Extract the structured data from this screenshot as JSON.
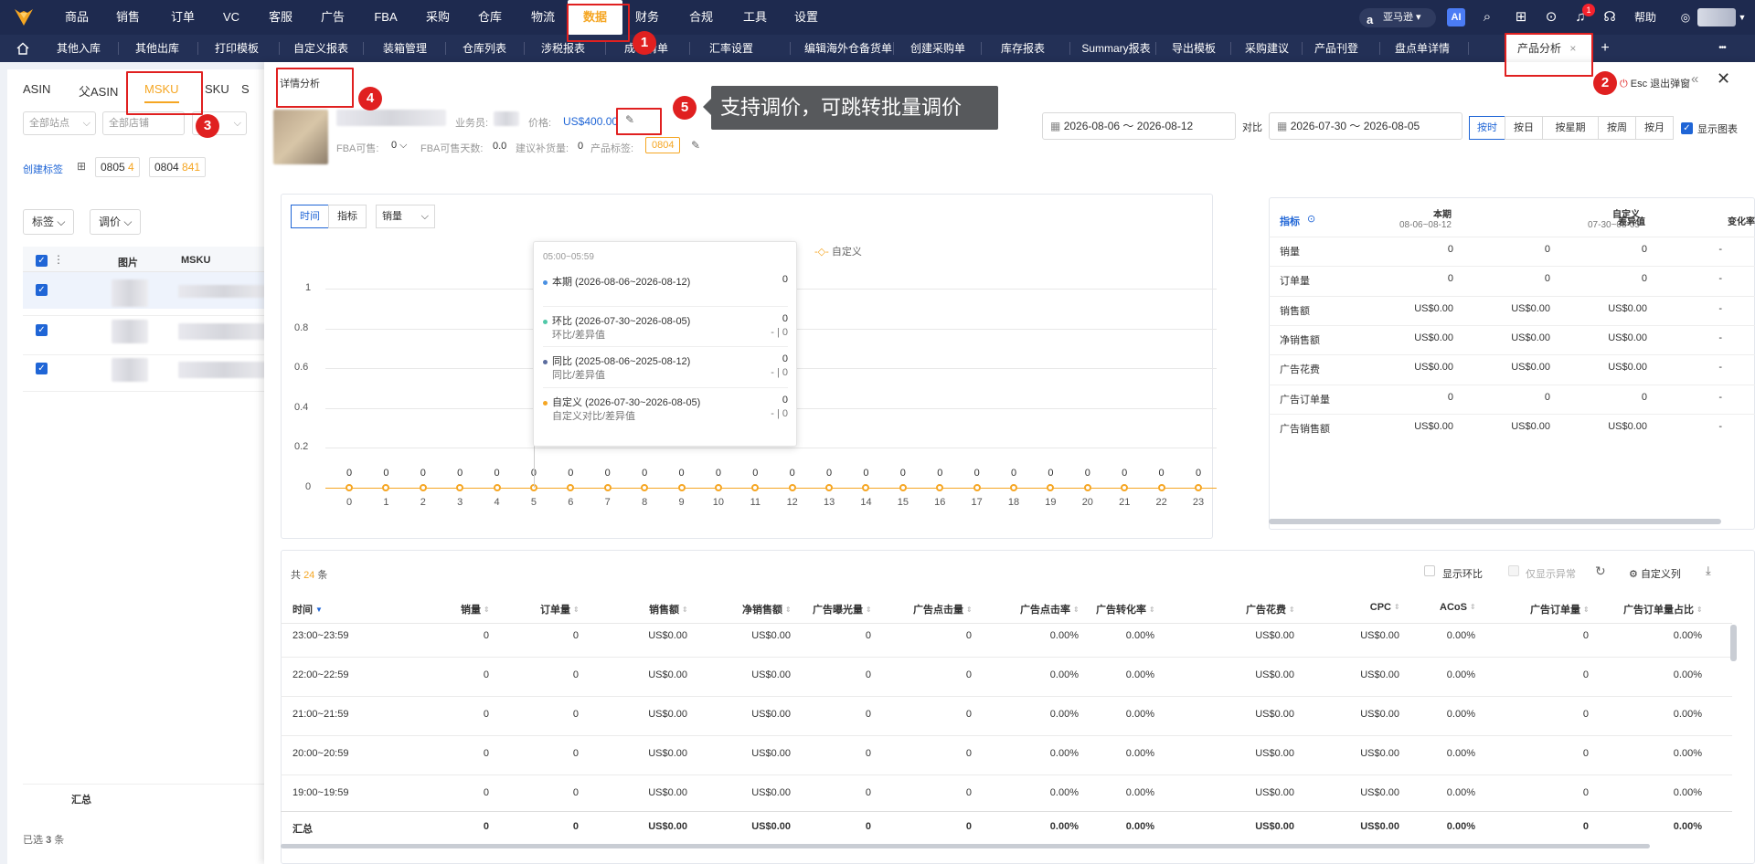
{
  "topnav": {
    "items": [
      "商品",
      "销售",
      "订单",
      "VC",
      "客服",
      "广告",
      "FBA",
      "采购",
      "仓库",
      "物流",
      "数据",
      "财务",
      "合规",
      "工具",
      "设置"
    ],
    "active": "数据",
    "marketplace": "亚马逊",
    "marketplace_icon": "a",
    "ai_label": "AI",
    "bell_count": "1",
    "help": "帮助"
  },
  "tabbar": {
    "tabs": [
      "其他入库",
      "其他出库",
      "打印模板",
      "自定义报表",
      "装箱管理",
      "仓库列表",
      "涉税报表",
      "成本清单",
      "汇率设置",
      "编辑海外仓备货单",
      "创建采购单",
      "库存报表",
      "Summary报表",
      "导出模板",
      "采购建议",
      "产品刊登",
      "盘点单详情"
    ],
    "active_tab": "产品分析",
    "close": "×",
    "add": "+",
    "more": "•••"
  },
  "left": {
    "tabs": [
      "ASIN",
      "父ASIN",
      "MSKU",
      "SKU",
      "S"
    ],
    "active_tab": "MSKU",
    "filters": [
      "全部站点",
      "全部店铺"
    ],
    "create_tag": "创建标签",
    "chips": [
      {
        "label": "0805",
        "count": "4"
      },
      {
        "label": "0804",
        "count": "841"
      }
    ],
    "btn_tag": "标签",
    "btn_price": "调价",
    "col_image": "图片",
    "col_msku": "MSKU",
    "total_label": "汇总",
    "selected_prefix": "已选",
    "selected_count": "3",
    "selected_suffix": "条"
  },
  "modal": {
    "title": "详情分析",
    "esc_text": "Esc 退出弹窗",
    "salesperson_label": "业务员:",
    "price_label": "价格:",
    "price_value": "US$400.00",
    "fba_avail_label": "FBA可售:",
    "fba_avail_value": "0",
    "fba_days_label": "FBA可售天数:",
    "fba_days_value": "0.0",
    "suggest_label": "建议补货量:",
    "suggest_value": "0",
    "tag_label": "产品标签:",
    "tag_value": "0804",
    "date_current_start": "2026-08-06",
    "date_current_end": "2026-08-12",
    "date_sep": "～",
    "compare_label": "对比",
    "date_compare_start": "2026-07-30",
    "date_compare_end": "2026-08-05",
    "granularity": [
      "按时",
      "按日",
      "按星期",
      "按周",
      "按月"
    ],
    "granularity_active": "按时",
    "show_chart": "显示图表"
  },
  "annotations": {
    "badges": [
      "1",
      "2",
      "3",
      "4",
      "5"
    ],
    "callout": "支持调价，可跳转批量调价"
  },
  "chart": {
    "tab_time": "时间",
    "tab_metric": "指标",
    "metric_select": "销量",
    "legend_custom": "自定义"
  },
  "chart_data": {
    "type": "line",
    "x": [
      0,
      1,
      2,
      3,
      4,
      5,
      6,
      7,
      8,
      9,
      10,
      11,
      12,
      13,
      14,
      15,
      16,
      17,
      18,
      19,
      20,
      21,
      22,
      23
    ],
    "series": [
      {
        "name": "自定义",
        "values": [
          0,
          0,
          0,
          0,
          0,
          0,
          0,
          0,
          0,
          0,
          0,
          0,
          0,
          0,
          0,
          0,
          0,
          0,
          0,
          0,
          0,
          0,
          0,
          0
        ],
        "color": "#f5a623"
      }
    ],
    "yticks": [
      "0",
      "0.2",
      "0.4",
      "0.6",
      "0.8",
      "1"
    ],
    "ylim": [
      0,
      1
    ],
    "grid": true
  },
  "tooltip": {
    "time": "05:00~05:59",
    "rows": [
      {
        "label": "本期 (2026-08-06~2026-08-12)",
        "value": "0",
        "color": "#4a90e2",
        "sub": "",
        "subval": ""
      },
      {
        "label": "环比 (2026-07-30~2026-08-05)",
        "value": "0",
        "color": "#50c8a8",
        "sub": "环比/差异值",
        "subval": "- | 0"
      },
      {
        "label": "同比 (2025-08-06~2025-08-12)",
        "value": "0",
        "color": "#5b6c9e",
        "sub": "同比/差异值",
        "subval": "- | 0"
      },
      {
        "label": "自定义 (2026-07-30~2026-08-05)",
        "value": "0",
        "color": "#f5a623",
        "sub": "自定义对比/差异值",
        "subval": "- | 0"
      }
    ]
  },
  "metrics_table": {
    "head": {
      "metric": "指标",
      "current": "本期",
      "current_range": "08-06~08-12",
      "custom": "自定义",
      "custom_range": "07-30~08-05",
      "diff": "差异值",
      "rate": "变化率"
    },
    "rows": [
      [
        "销量",
        "0",
        "0",
        "0",
        "-"
      ],
      [
        "订单量",
        "0",
        "0",
        "0",
        "-"
      ],
      [
        "销售额",
        "US$0.00",
        "US$0.00",
        "US$0.00",
        "-"
      ],
      [
        "净销售额",
        "US$0.00",
        "US$0.00",
        "US$0.00",
        "-"
      ],
      [
        "广告花费",
        "US$0.00",
        "US$0.00",
        "US$0.00",
        "-"
      ],
      [
        "广告订单量",
        "0",
        "0",
        "0",
        "-"
      ],
      [
        "广告销售额",
        "US$0.00",
        "US$0.00",
        "US$0.00",
        "-"
      ]
    ]
  },
  "detail_table": {
    "count_prefix": "共",
    "count": "24",
    "count_suffix": "条",
    "show_hb": "显示环比",
    "only_abnormal": "仅显示异常",
    "custom_cols": "自定义列",
    "columns": [
      "时间",
      "销量",
      "订单量",
      "销售额",
      "净销售额",
      "广告曝光量",
      "广告点击量",
      "广告点击率",
      "广告转化率",
      "广告花费",
      "CPC",
      "ACoS",
      "广告订单量",
      "广告订单量占比"
    ],
    "rows": [
      [
        "23:00~23:59",
        "0",
        "0",
        "US$0.00",
        "US$0.00",
        "0",
        "0",
        "0.00%",
        "0.00%",
        "US$0.00",
        "US$0.00",
        "0.00%",
        "0",
        "0.00%"
      ],
      [
        "22:00~22:59",
        "0",
        "0",
        "US$0.00",
        "US$0.00",
        "0",
        "0",
        "0.00%",
        "0.00%",
        "US$0.00",
        "US$0.00",
        "0.00%",
        "0",
        "0.00%"
      ],
      [
        "21:00~21:59",
        "0",
        "0",
        "US$0.00",
        "US$0.00",
        "0",
        "0",
        "0.00%",
        "0.00%",
        "US$0.00",
        "US$0.00",
        "0.00%",
        "0",
        "0.00%"
      ],
      [
        "20:00~20:59",
        "0",
        "0",
        "US$0.00",
        "US$0.00",
        "0",
        "0",
        "0.00%",
        "0.00%",
        "US$0.00",
        "US$0.00",
        "0.00%",
        "0",
        "0.00%"
      ],
      [
        "19:00~19:59",
        "0",
        "0",
        "US$0.00",
        "US$0.00",
        "0",
        "0",
        "0.00%",
        "0.00%",
        "US$0.00",
        "US$0.00",
        "0.00%",
        "0",
        "0.00%"
      ]
    ],
    "total": [
      "汇总",
      "0",
      "0",
      "US$0.00",
      "US$0.00",
      "0",
      "0",
      "0.00%",
      "0.00%",
      "US$0.00",
      "US$0.00",
      "0.00%",
      "0",
      "0.00%"
    ]
  }
}
